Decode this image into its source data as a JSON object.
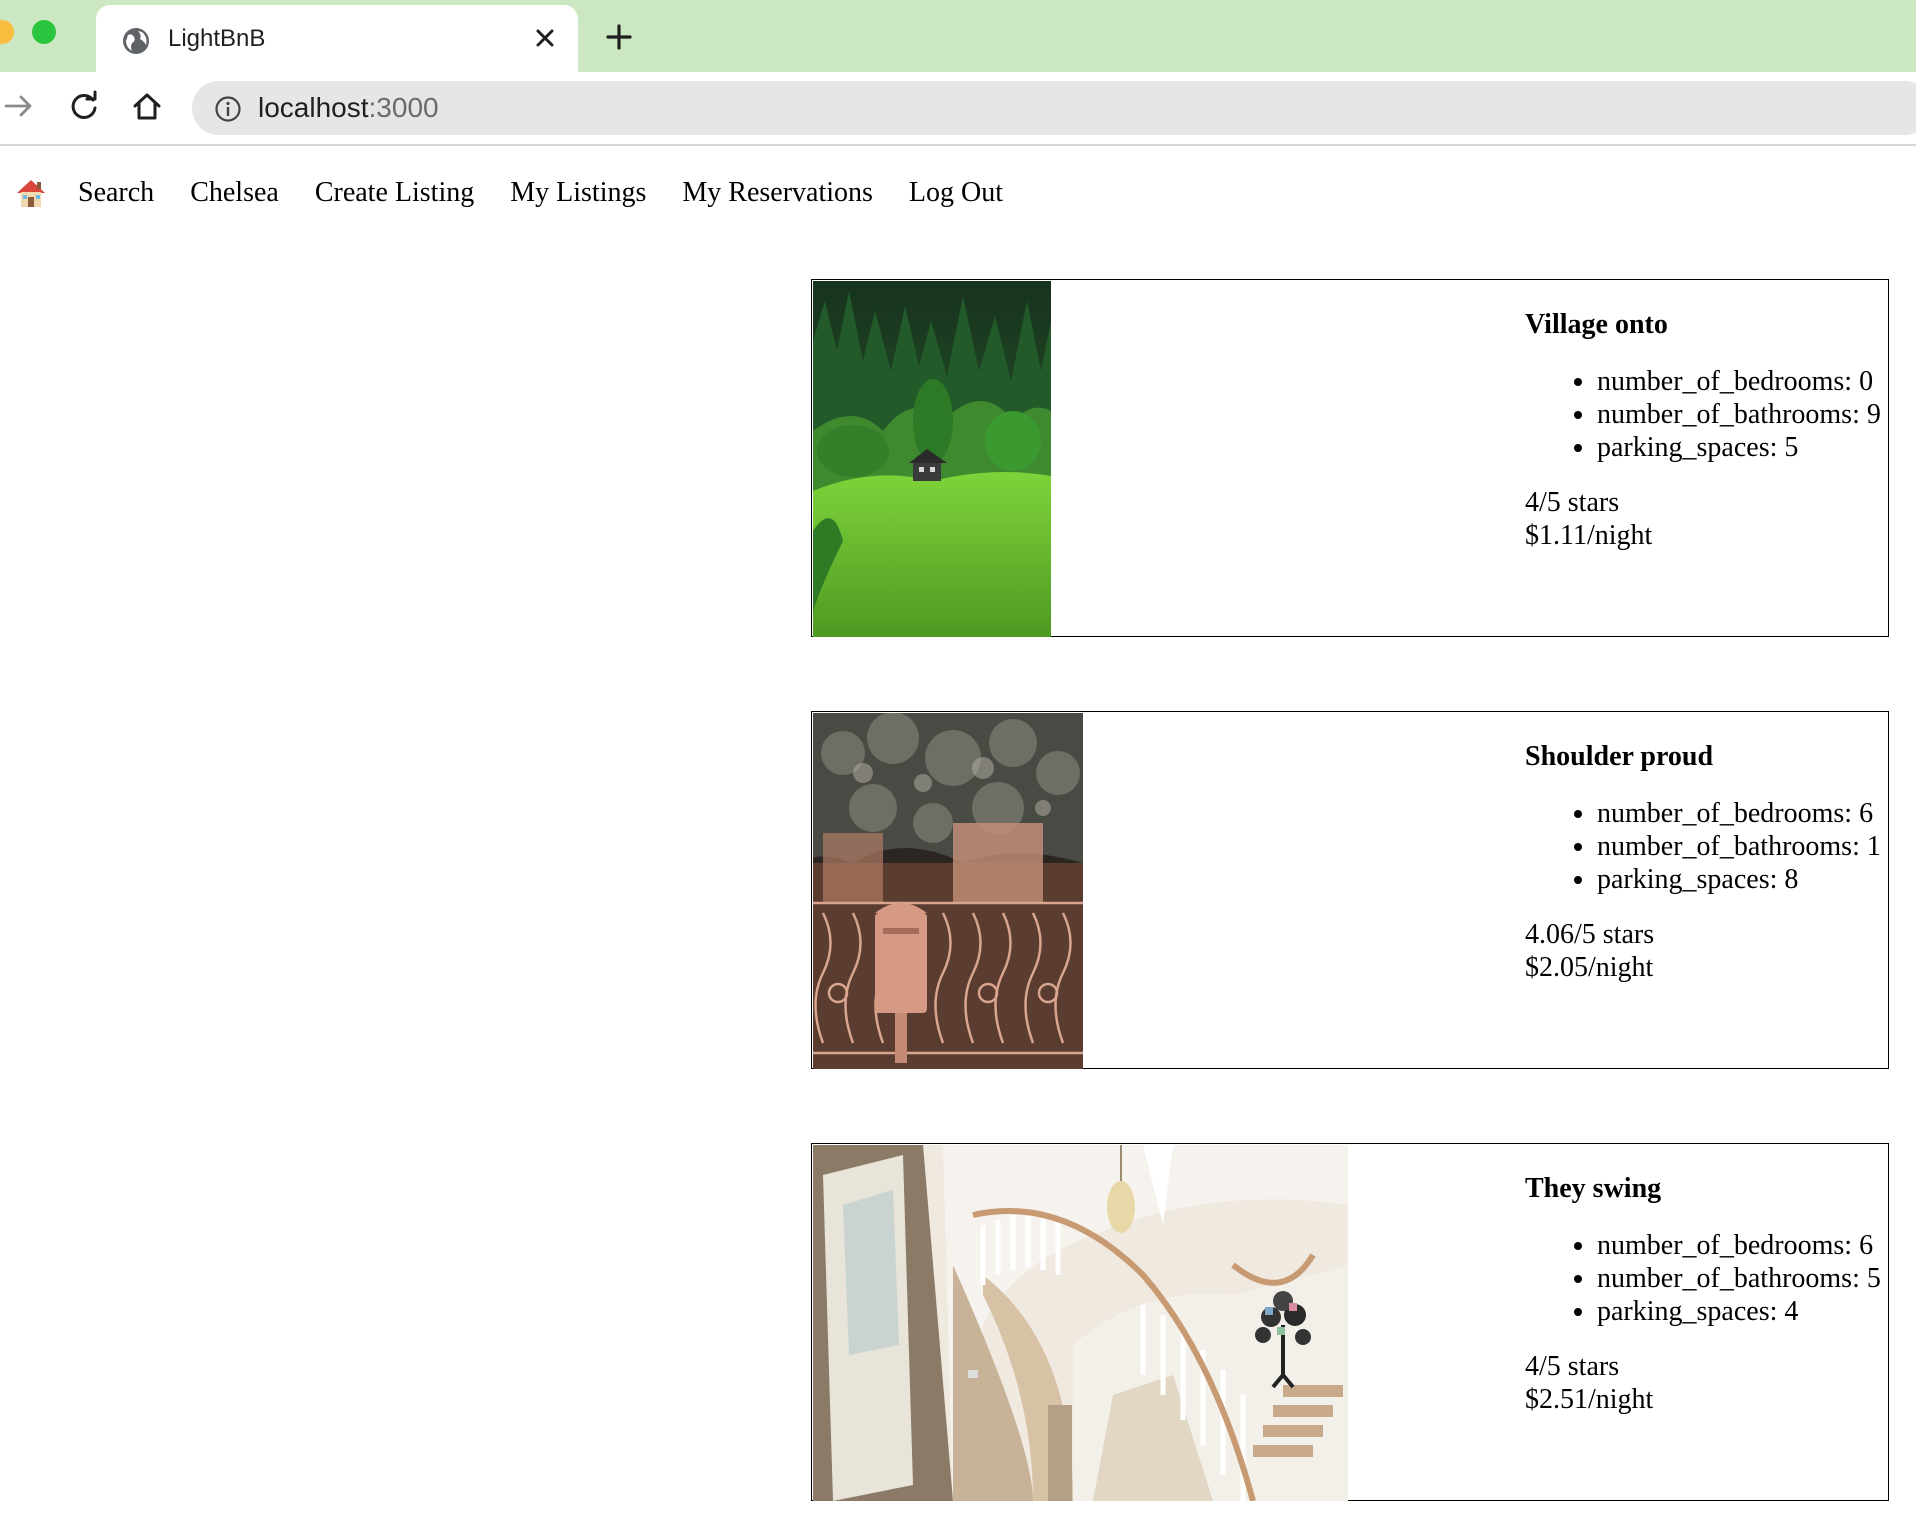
{
  "browser": {
    "tab_title": "LightBnB",
    "url_host": "localhost",
    "url_port": ":3000"
  },
  "nav": {
    "home_icon": "house-emoji-icon",
    "links": [
      "Search",
      "Chelsea",
      "Create Listing",
      "My Listings",
      "My Reservations",
      "Log Out"
    ]
  },
  "listings": [
    {
      "title": "Village onto",
      "features": [
        "number_of_bedrooms: 0",
        "number_of_bathrooms: 9",
        "parking_spaces: 5"
      ],
      "rating": "4/5 stars",
      "price": "$1.11/night",
      "photo": "green-hillside-cabin-photo"
    },
    {
      "title": "Shoulder proud",
      "features": [
        "number_of_bedrooms: 6",
        "number_of_bathrooms: 1",
        "parking_spaces: 8"
      ],
      "rating": "4.06/5 stars",
      "price": "$2.05/night",
      "photo": "ornate-gate-mailbox-photo"
    },
    {
      "title": "They swing",
      "features": [
        "number_of_bedrooms: 6",
        "number_of_bathrooms: 5",
        "parking_spaces: 4"
      ],
      "rating": "4/5 stars",
      "price": "$2.51/night",
      "photo": "staircase-foyer-photo"
    }
  ]
}
